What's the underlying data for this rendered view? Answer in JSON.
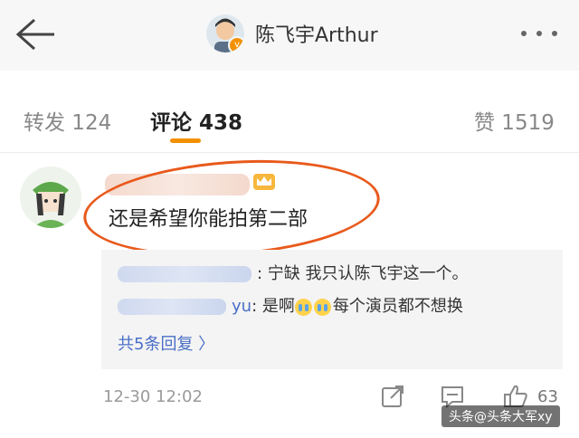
{
  "header": {
    "title": "陈飞宇Arthur",
    "verified_badge": "v",
    "icons": {
      "back": "back-arrow-icon",
      "more": "more-dots-icon"
    }
  },
  "tabs": [
    {
      "label": "转发 124"
    },
    {
      "label": "评论 438",
      "active": true
    },
    {
      "label": "赞 1519"
    }
  ],
  "comment": {
    "text": "还是希望你能拍第二部",
    "icons": {
      "badge": "crown-badge-icon"
    },
    "replies": [
      {
        "text": ": 宁缺 我只认陈飞宇这一个。"
      },
      {
        "name_suffix": "yu",
        "text_before": ": 是啊",
        "text_after": "每个演员都不想换"
      }
    ],
    "more_replies": "共5条回复 〉",
    "timestamp": "12-30 12:02",
    "like_count": "63"
  },
  "colors": {
    "accent": "#f29100",
    "link": "#4a6fc7",
    "annotation": "#e8591b"
  },
  "watermark": "头条@头条大军xy"
}
